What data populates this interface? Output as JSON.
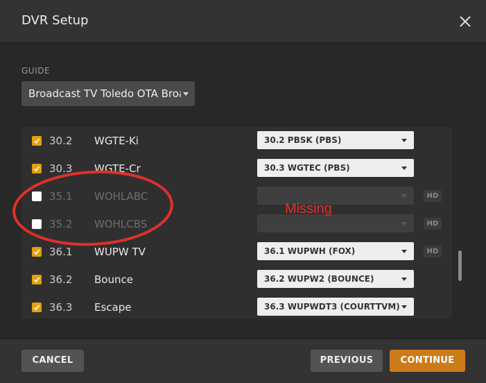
{
  "header": {
    "title": "DVR Setup"
  },
  "guide": {
    "label": "GUIDE",
    "selected": "Broadcast TV Toledo OTA Broa"
  },
  "channels": [
    {
      "number": "30.2",
      "name": "WGTE-Ki",
      "checked": true,
      "mapping": "30.2 PBSK (PBS)",
      "hd": false,
      "enabled": true
    },
    {
      "number": "30.3",
      "name": "WGTE-Cr",
      "checked": true,
      "mapping": "30.3 WGTEC (PBS)",
      "hd": false,
      "enabled": true
    },
    {
      "number": "35.1",
      "name": "WOHLABC",
      "checked": false,
      "mapping": "",
      "hd": true,
      "enabled": false
    },
    {
      "number": "35.2",
      "name": "WOHLCBS",
      "checked": false,
      "mapping": "",
      "hd": true,
      "enabled": false
    },
    {
      "number": "36.1",
      "name": "WUPW TV",
      "checked": true,
      "mapping": "36.1 WUPWH (FOX)",
      "hd": true,
      "enabled": true
    },
    {
      "number": "36.2",
      "name": "Bounce",
      "checked": true,
      "mapping": "36.2 WUPW2 (BOUNCE)",
      "hd": false,
      "enabled": true
    },
    {
      "number": "36.3",
      "name": "Escape",
      "checked": true,
      "mapping": "36.3 WUPWDT3 (COURTTVM)",
      "hd": false,
      "enabled": true
    }
  ],
  "hd_label": "HD",
  "annotation": {
    "text": "Missing",
    "color": "#e0302a"
  },
  "footer": {
    "cancel_label": "CANCEL",
    "previous_label": "PREVIOUS",
    "continue_label": "CONTINUE"
  },
  "colors": {
    "accent": "#e5a00d",
    "continue": "#cc7b19"
  },
  "icons": {
    "close": "close-icon",
    "check": "check-icon",
    "dropdown": "chevron-down-icon"
  }
}
